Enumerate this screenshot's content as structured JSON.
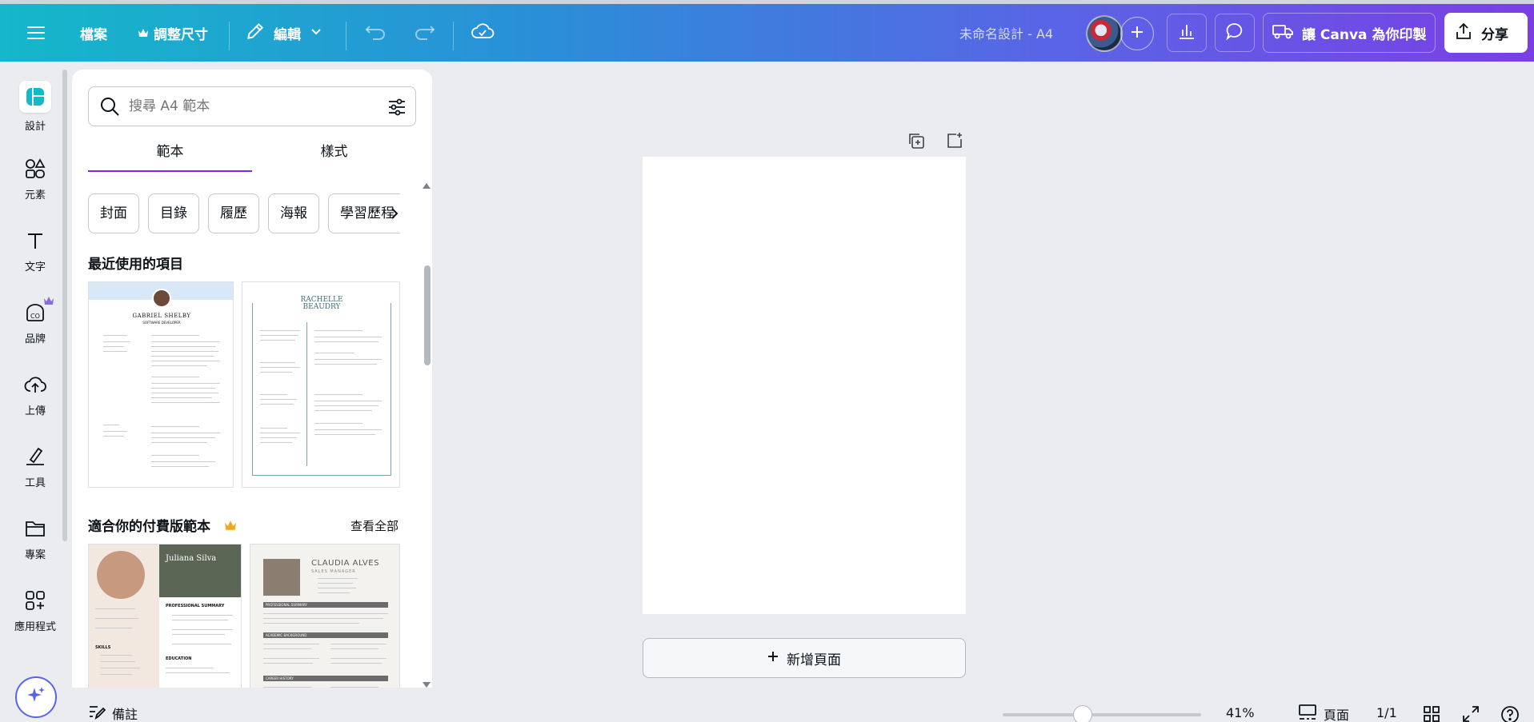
{
  "topbar": {
    "file": "檔案",
    "resize": "調整尺寸",
    "edit": "編輯",
    "doc_title": "未命名設計 - A4",
    "print": "讓 Canva 為你印製",
    "share": "分享"
  },
  "rail": {
    "items": [
      {
        "label": "設計"
      },
      {
        "label": "元素"
      },
      {
        "label": "文字"
      },
      {
        "label": "品牌"
      },
      {
        "label": "上傳"
      },
      {
        "label": "工具"
      },
      {
        "label": "專案"
      },
      {
        "label": "應用程式"
      }
    ]
  },
  "panel": {
    "search_placeholder": "搜尋 A4 範本",
    "tabs": [
      "範本",
      "樣式"
    ],
    "chips": [
      "封面",
      "目錄",
      "履歷",
      "海報",
      "學習歷程"
    ],
    "recent_title": "最近使用的項目",
    "premium_title": "適合你的付費版範本",
    "see_all": "查看全部",
    "recent": [
      {
        "name": "GABRIEL SHELBY",
        "role": "SOFTWARE DEVELOPER"
      },
      {
        "name": "RACHELLE\nBEAUDRY",
        "role": ""
      }
    ],
    "premium": [
      {
        "name": "Juliana Silva",
        "sections": [
          "PROFESSIONAL SUMMARY",
          "EDUCATION",
          "SKILLS"
        ]
      },
      {
        "name": "CLAUDIA ALVES",
        "role": "SALES MANAGER",
        "sections": [
          "PROFESSIONAL SUMMARY",
          "ACADEMIC BACKGROUND",
          "CAREER HISTORY"
        ]
      }
    ]
  },
  "canvas": {
    "add_page": "新增頁面"
  },
  "bottom": {
    "notes": "備註",
    "zoom": "41%",
    "pages_label": "頁面",
    "page_count": "1/1"
  },
  "colors": {
    "accent": "#7d2ae8",
    "topbar_start": "#14b8c9",
    "topbar_end": "#7a3fe4"
  }
}
